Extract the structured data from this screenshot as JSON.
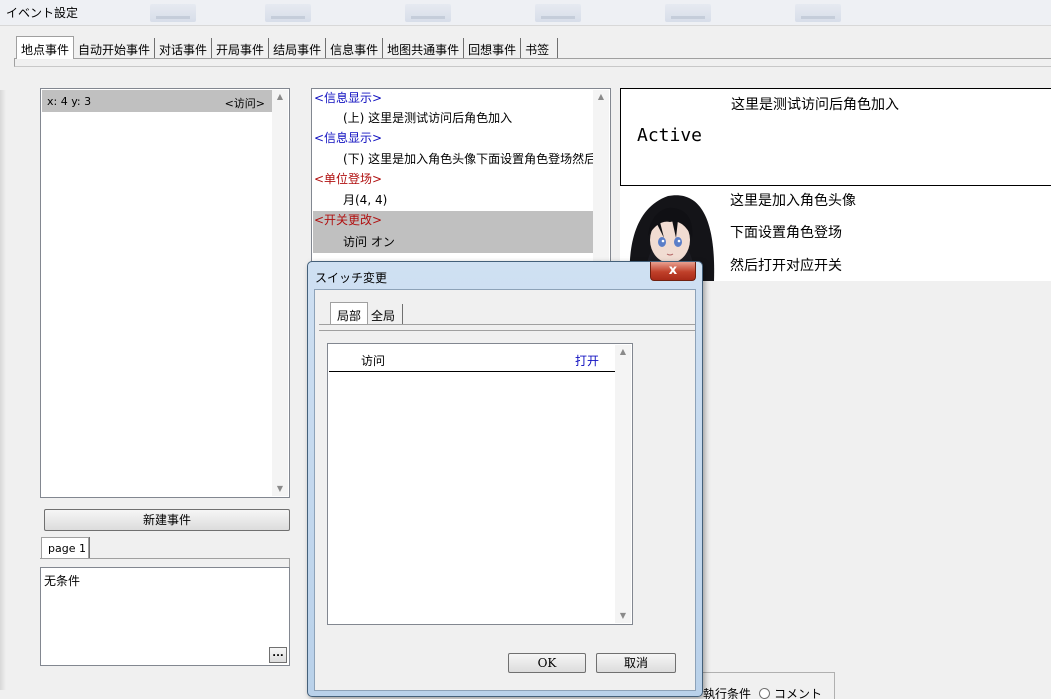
{
  "window": {
    "title": "イベント設定"
  },
  "tabs": [
    "地点事件",
    "自动开始事件",
    "对话事件",
    "开局事件",
    "结局事件",
    "信息事件",
    "地图共通事件",
    "回想事件",
    "书签"
  ],
  "event_list": {
    "item": {
      "coords": "x: 4 y: 3",
      "tag": "<访问>"
    }
  },
  "new_event_button": "新建事件",
  "page_tab": "page 1",
  "condition": {
    "text": "无条件",
    "more_button": "..."
  },
  "commands": [
    {
      "text": "<信息显示>",
      "kind": "head",
      "color": "#1010c0"
    },
    {
      "text": "(上) 这里是测试访问后角色加入",
      "kind": "body"
    },
    {
      "text": "<信息显示>",
      "kind": "head",
      "color": "#1010c0"
    },
    {
      "text": "(下) 这里是加入角色头像下面设置角色登场然后",
      "kind": "body"
    },
    {
      "text": "<单位登场>",
      "kind": "head",
      "color": "#b01010"
    },
    {
      "text": "月(4, 4)",
      "kind": "body"
    },
    {
      "text": "<开关更改>",
      "kind": "head",
      "color": "#b01010",
      "selected": true
    },
    {
      "text": "访问 オン",
      "kind": "body",
      "selected": true
    }
  ],
  "preview": {
    "top_message": "这里是测试访问后角色加入",
    "active_label": "Active",
    "bottom_lines": [
      "这里是加入角色头像",
      "下面设置角色登场",
      "然后打开对应开关"
    ]
  },
  "dialog": {
    "title": "スイッチ変更",
    "close_label": "x",
    "tabs": [
      "局部",
      "全局"
    ],
    "switch": {
      "name": "访问",
      "value": "打开"
    },
    "ok_label": "OK",
    "cancel_label": "取消"
  },
  "bottom": {
    "exec_condition": "執行条件",
    "comment": "コメント"
  }
}
